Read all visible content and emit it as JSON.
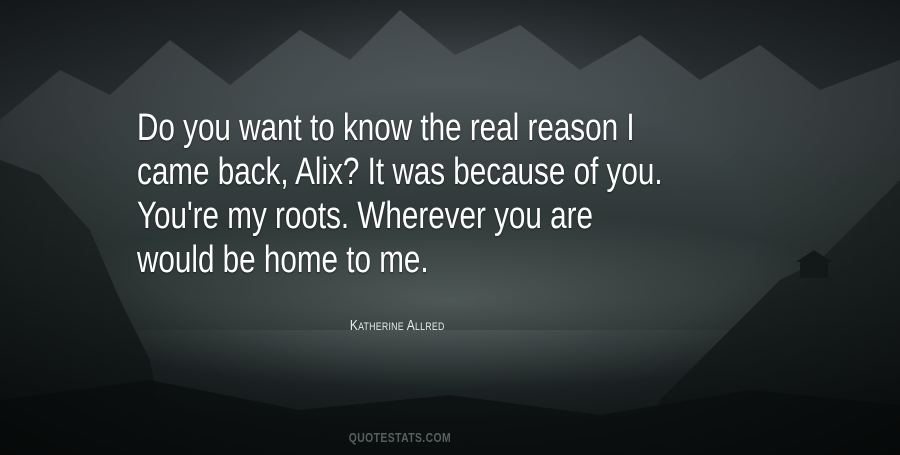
{
  "quote": {
    "lines": [
      "Do you want to know the real reason I",
      "came back, Alix? It was because of you.",
      "You're my roots. Wherever you are",
      "would be home to me."
    ],
    "author": "Katherine Allred"
  },
  "watermark": "QUOTESTATS.COM",
  "background": {
    "subject": "misty-mountain-landscape",
    "colors": {
      "sky": "#2f3739",
      "mist": "#7d8a86",
      "shadow": "#121718"
    }
  }
}
